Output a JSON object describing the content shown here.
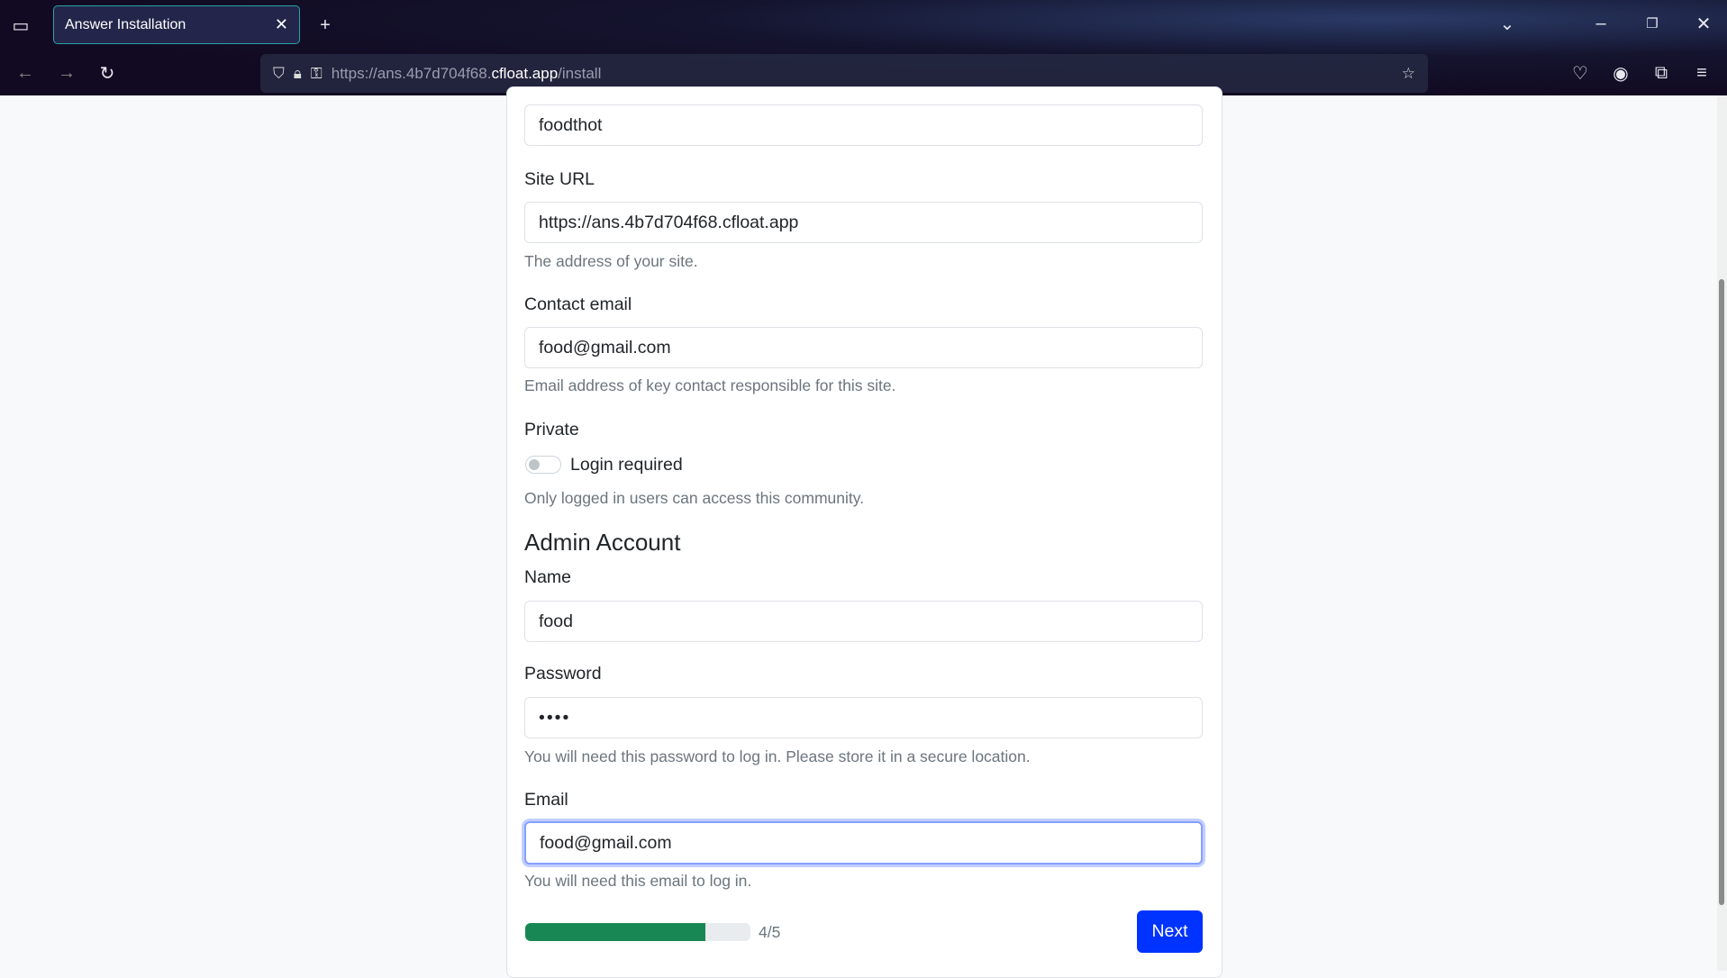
{
  "browser": {
    "tab_title": "Answer Installation",
    "url_prefix": "https://ans.4b7d704f68.",
    "url_host": "cfloat.app",
    "url_path": "/install"
  },
  "form": {
    "site_name_value": "foodthot",
    "site_url": {
      "label": "Site URL",
      "value": "https://ans.4b7d704f68.cfloat.app",
      "help": "The address of your site."
    },
    "contact_email": {
      "label": "Contact email",
      "value": "food@gmail.com",
      "help": "Email address of key contact responsible for this site."
    },
    "private": {
      "label": "Private",
      "toggle_label": "Login required",
      "checked": false,
      "help": "Only logged in users can access this community."
    },
    "admin_heading": "Admin Account",
    "name": {
      "label": "Name",
      "value": "food"
    },
    "password": {
      "label": "Password",
      "value": "••••",
      "help": "You will need this password to log in. Please store it in a secure location."
    },
    "email": {
      "label": "Email",
      "value": "food@gmail.com",
      "help": "You will need this email to log in."
    },
    "progress": {
      "percent": 80,
      "label": "4/5"
    },
    "next_label": "Next"
  },
  "colors": {
    "primary": "#0033ff",
    "progress": "#198754"
  }
}
